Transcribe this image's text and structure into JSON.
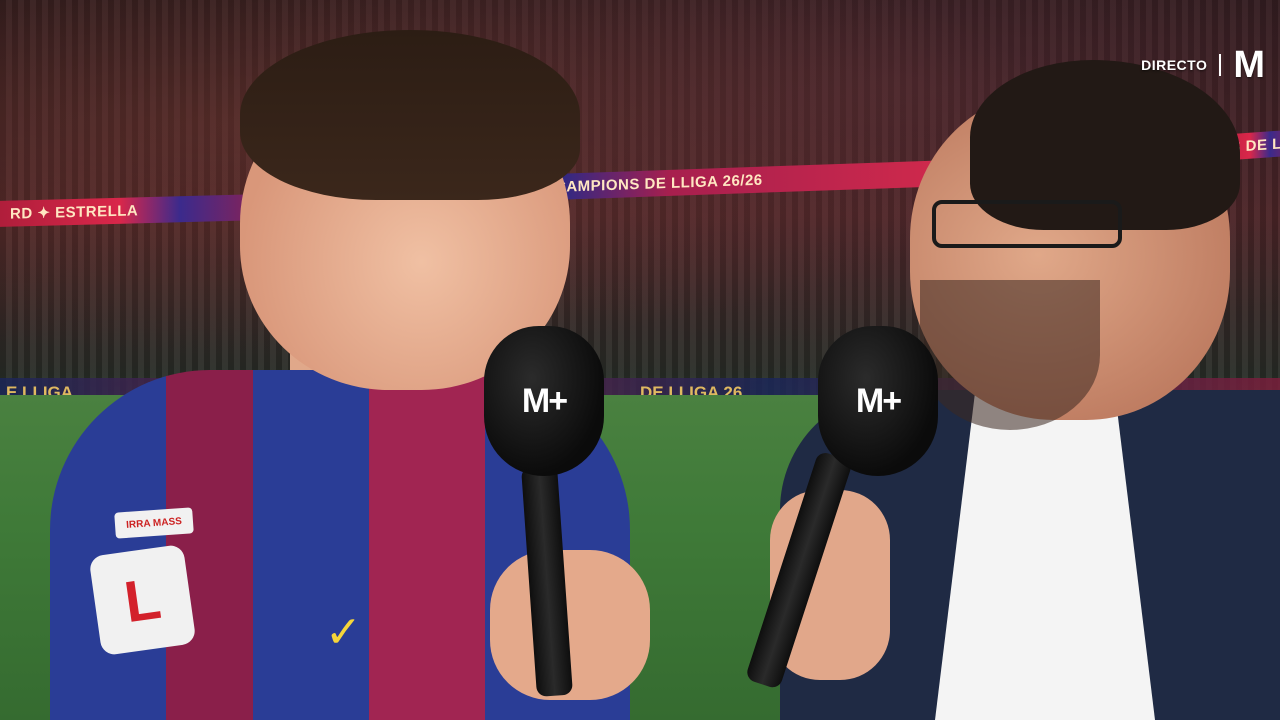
{
  "broadcast": {
    "live_label": "DIRECTO",
    "logo_text": "M"
  },
  "banners": {
    "ribbon_left": "RD  ✦  ESTRELLA",
    "ribbon_center": "CAMPIONS DE LLIGA 26/26",
    "ribbon_right": "ES DE LL",
    "adboard_left": "E LLIGA",
    "adboard_center": "DE LLIGA 26"
  },
  "microphones": {
    "player_mic_logo": "M+",
    "host_mic_logo": "M+"
  },
  "jersey": {
    "patch_top_text": "IRRA MASS",
    "patch_text": "L"
  },
  "colors": {
    "brand_accent": "#ffffff",
    "jersey_blue": "#2a3d96",
    "jersey_maroon": "#a12552",
    "pitch_green": "#3f7a38"
  }
}
